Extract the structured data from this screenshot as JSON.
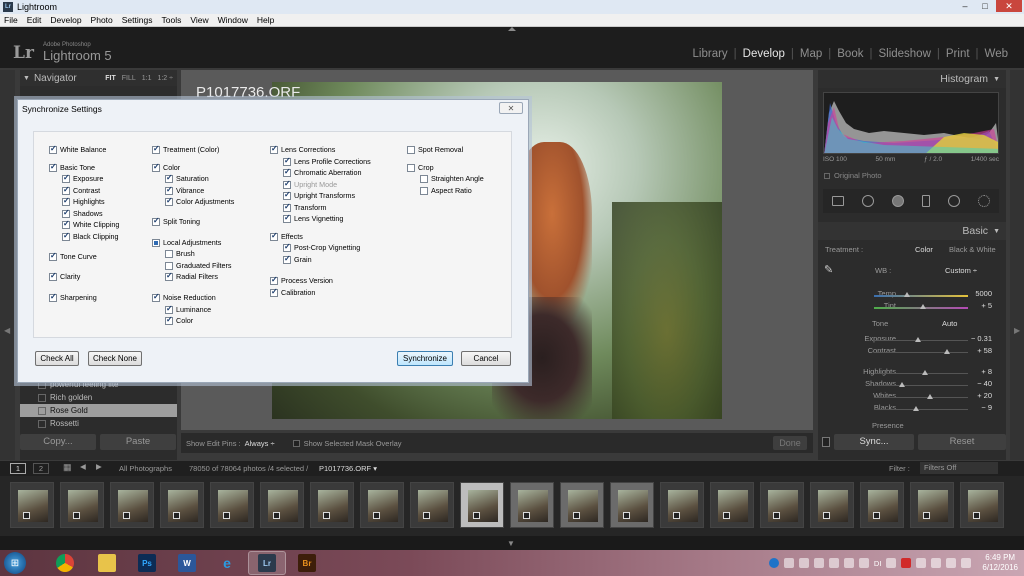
{
  "window": {
    "title": "Lightroom",
    "controls": [
      "–",
      "□",
      "✕"
    ]
  },
  "menu": [
    "File",
    "Edit",
    "Develop",
    "Photo",
    "Settings",
    "Tools",
    "View",
    "Window",
    "Help"
  ],
  "app": {
    "logo": "Lr",
    "vendor": "Adobe Photoshop",
    "name": "Lightroom 5"
  },
  "modules": [
    "Library",
    "Develop",
    "Map",
    "Book",
    "Slideshow",
    "Print",
    "Web"
  ],
  "active_module": "Develop",
  "navigator": {
    "title": "Navigator",
    "options": [
      "FIT",
      "FILL",
      "1:1",
      "1:2 ÷"
    ]
  },
  "presets": [
    "powerful feeling lite",
    "Rich golden",
    "Rose Gold",
    "Rossetti"
  ],
  "left_buttons": {
    "copy": "Copy...",
    "paste": "Paste"
  },
  "photo": {
    "name": "P1017736.ORF"
  },
  "toolbar": {
    "edit_pins_label": "Show Edit Pins :",
    "edit_pins_value": "Always ÷",
    "mask_overlay": "Show Selected Mask Overlay",
    "done": "Done"
  },
  "histogram": {
    "title": "Histogram",
    "iso": "ISO 100",
    "focal": "50 mm",
    "aperture": "ƒ / 2.0",
    "shutter": "1/400 sec",
    "original": "Original Photo"
  },
  "basic": {
    "title": "Basic",
    "treatment_label": "Treatment :",
    "color": "Color",
    "bw": "Black & White",
    "wb_label": "WB :",
    "wb_value": "Custom ÷",
    "tone_label": "Tone",
    "auto": "Auto",
    "presence": "Presence",
    "sliders": [
      {
        "label": "Temp",
        "value": "5000",
        "pos": 0.35
      },
      {
        "label": "Tint",
        "value": "+ 5",
        "pos": 0.52
      },
      {
        "label": "Exposure",
        "value": "− 0.31",
        "pos": 0.47
      },
      {
        "label": "Contrast",
        "value": "+ 58",
        "pos": 0.78
      },
      {
        "label": "Highlights",
        "value": "+ 8",
        "pos": 0.54
      },
      {
        "label": "Shadows",
        "value": "− 40",
        "pos": 0.3
      },
      {
        "label": "Whites",
        "value": "+ 20",
        "pos": 0.6
      },
      {
        "label": "Blacks",
        "value": "− 9",
        "pos": 0.45
      }
    ]
  },
  "right_buttons": {
    "sync": "Sync...",
    "reset": "Reset"
  },
  "filmstrip": {
    "pages": [
      "1",
      "2"
    ],
    "source": "All Photographs",
    "count": "78050 of 78064 photos /4 selected /",
    "file": "P1017736.ORF ▾",
    "filter_label": "Filter :",
    "filter_value": "Filters Off"
  },
  "dialog": {
    "title": "Synchronize Settings",
    "close": "✕",
    "check_all": "Check All",
    "check_none": "Check None",
    "synchronize": "Synchronize",
    "cancel": "Cancel",
    "checkboxes": [
      {
        "label": "White Balance",
        "state": "on"
      },
      {
        "label": "Basic Tone",
        "state": "on"
      },
      {
        "label": "Exposure",
        "state": "on"
      },
      {
        "label": "Contrast",
        "state": "on"
      },
      {
        "label": "Highlights",
        "state": "on"
      },
      {
        "label": "Shadows",
        "state": "on"
      },
      {
        "label": "White Clipping",
        "state": "on"
      },
      {
        "label": "Black Clipping",
        "state": "on"
      },
      {
        "label": "Tone Curve",
        "state": "on"
      },
      {
        "label": "Clarity",
        "state": "on"
      },
      {
        "label": "Sharpening",
        "state": "on"
      },
      {
        "label": "Treatment (Color)",
        "state": "on"
      },
      {
        "label": "Color",
        "state": "on"
      },
      {
        "label": "Saturation",
        "state": "on"
      },
      {
        "label": "Vibrance",
        "state": "on"
      },
      {
        "label": "Color Adjustments",
        "state": "on"
      },
      {
        "label": "Split Toning",
        "state": "on"
      },
      {
        "label": "Local Adjustments",
        "state": "part"
      },
      {
        "label": "Brush",
        "state": "off"
      },
      {
        "label": "Graduated Filters",
        "state": "off"
      },
      {
        "label": "Radial Filters",
        "state": "on"
      },
      {
        "label": "Noise Reduction",
        "state": "on"
      },
      {
        "label": "Luminance",
        "state": "on"
      },
      {
        "label": "Color",
        "state": "on"
      },
      {
        "label": "Lens Corrections",
        "state": "on"
      },
      {
        "label": "Lens Profile Corrections",
        "state": "on"
      },
      {
        "label": "Chromatic Aberration",
        "state": "on"
      },
      {
        "label": "Upright Mode",
        "state": "dim"
      },
      {
        "label": "Upright Transforms",
        "state": "on"
      },
      {
        "label": "Transform",
        "state": "on"
      },
      {
        "label": "Lens Vignetting",
        "state": "on"
      },
      {
        "label": "Effects",
        "state": "on"
      },
      {
        "label": "Post-Crop Vignetting",
        "state": "on"
      },
      {
        "label": "Grain",
        "state": "on"
      },
      {
        "label": "Process Version",
        "state": "on"
      },
      {
        "label": "Calibration",
        "state": "on"
      },
      {
        "label": "Spot Removal",
        "state": "off"
      },
      {
        "label": "Crop",
        "state": "off"
      },
      {
        "label": "Straighten Angle",
        "state": "off"
      },
      {
        "label": "Aspect Ratio",
        "state": "off"
      }
    ]
  },
  "taskbar": {
    "apps": [
      "Chrome",
      "Explorer",
      "Ps",
      "Word",
      "IE",
      "Lr",
      "Br"
    ],
    "tray": [
      "DI"
    ],
    "time": "6:49 PM",
    "date": "6/12/2016"
  },
  "colors": {
    "lr_bg": "#1d1d1d",
    "panel": "#2c2c2c",
    "dialog": "#eef2f7",
    "primary_btn": "#bee6fd"
  }
}
